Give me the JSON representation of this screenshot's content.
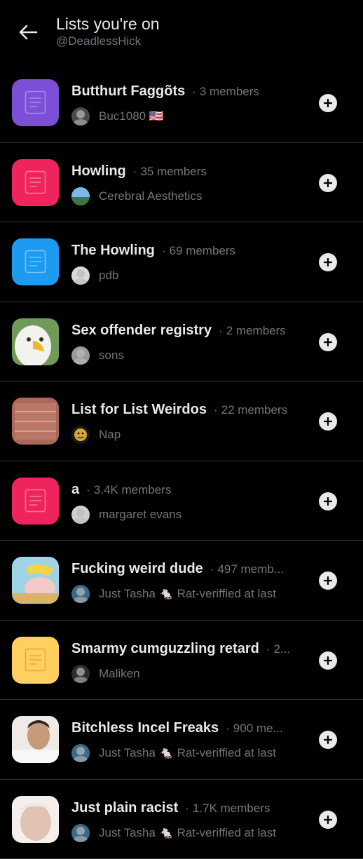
{
  "header": {
    "title": "Lists you're on",
    "handle": "@DeadlessHick"
  },
  "colors": {
    "background": "#000000",
    "divider": "#2f3336",
    "secondary_text": "#71767b",
    "purple": "#7b4fd6",
    "pink": "#f0245d",
    "blue": "#1d9bf0",
    "yellow": "#ffd060"
  },
  "lists": [
    {
      "name": "Butthurt Faggõts",
      "sep": "·",
      "members": "3 members",
      "owner": "Buc1080 🇺🇸",
      "avatar_type": "icon",
      "avatar_color": "#7b4fd6"
    },
    {
      "name": "Howling",
      "sep": "·",
      "members": "35 members",
      "owner": "Cerebral Aesthetics",
      "avatar_type": "icon",
      "avatar_color": "#f0245d"
    },
    {
      "name": "The Howling",
      "sep": "·",
      "members": "69 members",
      "owner": "pdb",
      "avatar_type": "icon",
      "avatar_color": "#1d9bf0"
    },
    {
      "name": "Sex offender registry",
      "sep": "·",
      "members": "2 members",
      "owner": "sons",
      "avatar_type": "eagle-photo",
      "avatar_color": "#5a8a4a"
    },
    {
      "name": "List for List Weirdos",
      "sep": "·",
      "members": "22 members",
      "owner": "Nap",
      "avatar_type": "stamp-photo",
      "avatar_color": "#b06a5c"
    },
    {
      "name": "a",
      "sep": "·",
      "members": "3.4K members",
      "owner": "margaret evans",
      "avatar_type": "icon",
      "avatar_color": "#f0245d"
    },
    {
      "name": "Fucking weird dude",
      "sep": "·",
      "members": "497 memb...",
      "owner": "Just Tasha 🐁 Rat-veriffied at last",
      "avatar_type": "cartoon-photo",
      "avatar_color": "#d9b98a"
    },
    {
      "name": "Smarmy cumguzzling retard",
      "sep": "·",
      "members": "2...",
      "owner": "Maliken",
      "avatar_type": "icon",
      "avatar_color": "#ffd060"
    },
    {
      "name": "Bitchless Incel Freaks",
      "sep": "·",
      "members": "900 me...",
      "owner": "Just Tasha 🐁 Rat-veriffied at last",
      "avatar_type": "man-photo",
      "avatar_color": "#c8a98a"
    },
    {
      "name": "Just plain racist",
      "sep": "·",
      "members": "1.7K members",
      "owner": "Just Tasha 🐁 Rat-veriffied at last",
      "avatar_type": "woman-photo",
      "avatar_color": "#d8c4b8"
    }
  ]
}
